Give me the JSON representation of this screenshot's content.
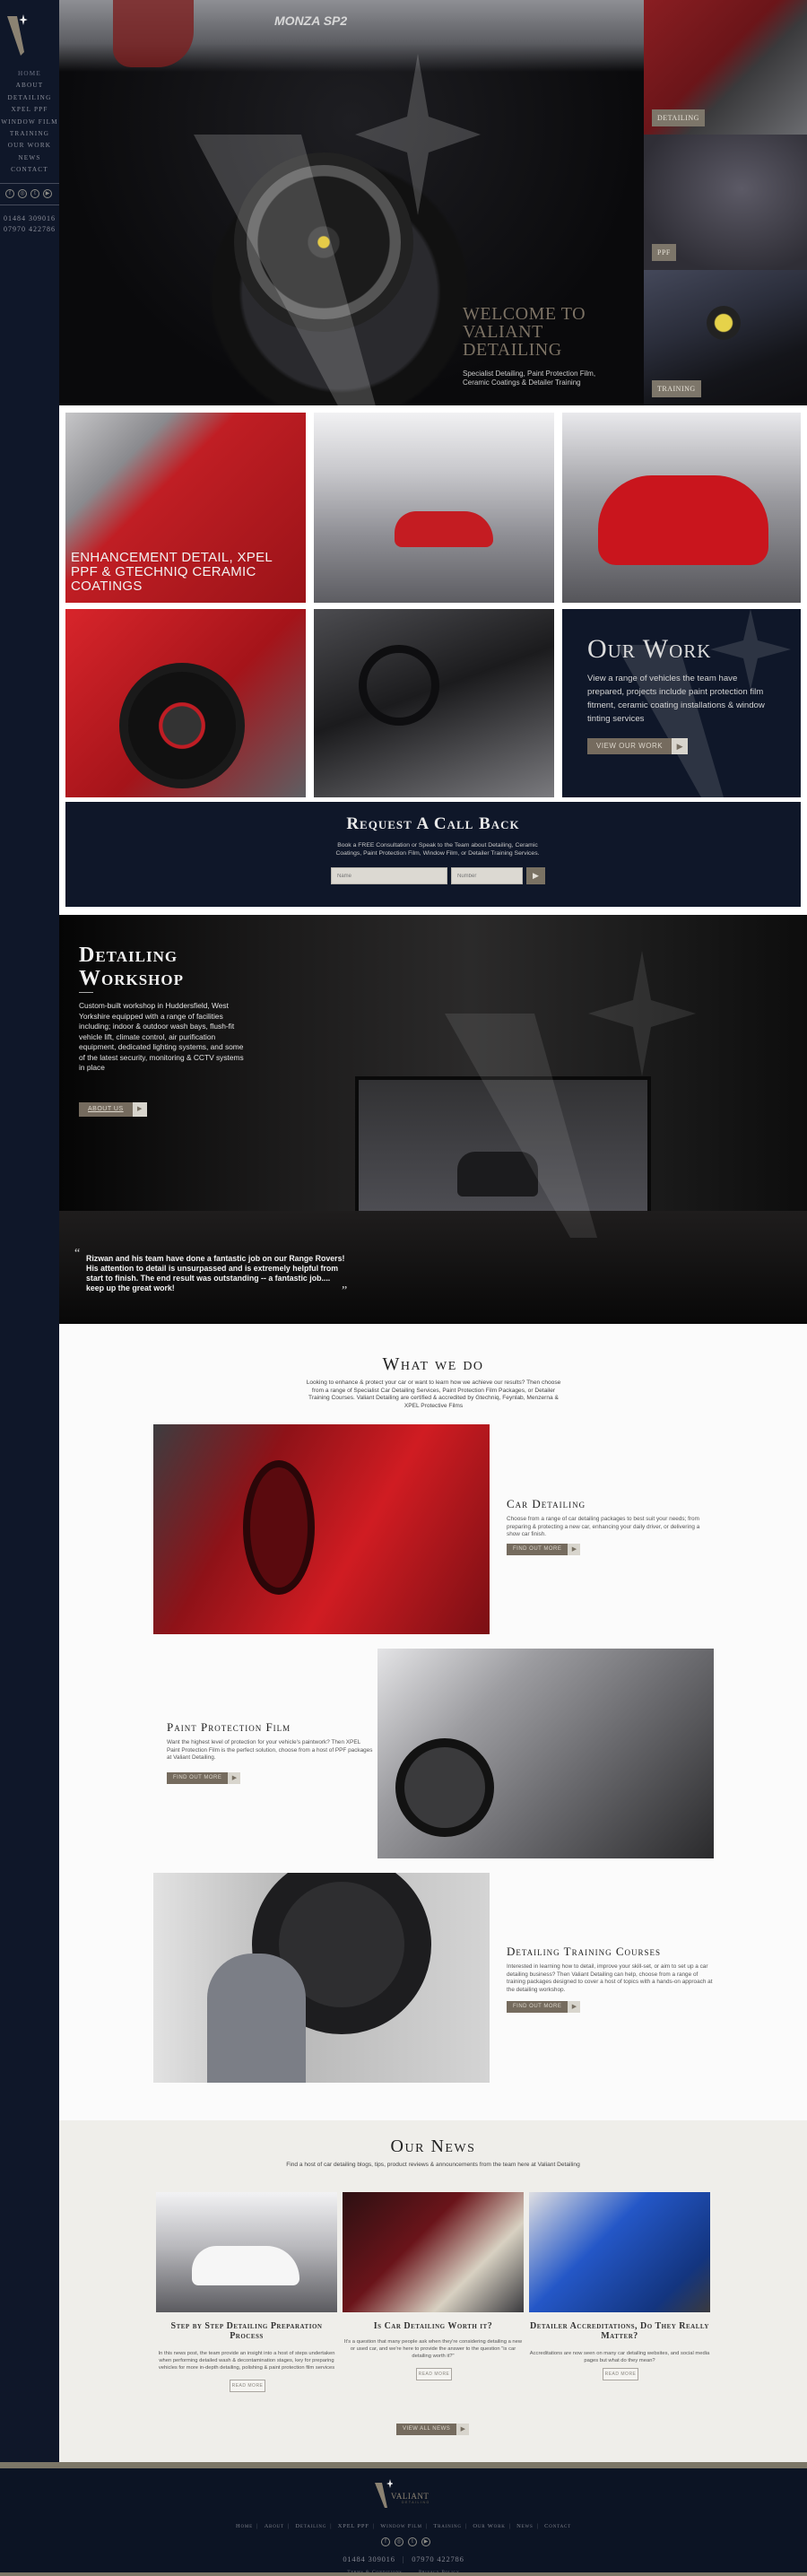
{
  "brand": {
    "name": "VALIANT",
    "tagline": "DETAILING",
    "colors": {
      "navy": "#0f1729",
      "taupe": "#756b5e",
      "light": "#dcd9d2",
      "cream": "#efeeea"
    }
  },
  "sidebar": {
    "nav": [
      "Home",
      "About",
      "Detailing",
      "XPEL PPF",
      "Window Film",
      "Training",
      "Our Work",
      "News",
      "Contact"
    ],
    "social": [
      {
        "icon": "facebook-icon",
        "glyph": "f"
      },
      {
        "icon": "instagram-icon",
        "glyph": "◎"
      },
      {
        "icon": "twitter-icon",
        "glyph": "t"
      },
      {
        "icon": "youtube-icon",
        "glyph": "▶"
      }
    ],
    "phones": [
      "01484 309016",
      "07970 422786"
    ]
  },
  "hero": {
    "car_badge": "MONZA SP2",
    "title_lines": [
      "Welcome to",
      "Valiant",
      "Detailing"
    ],
    "subtitle_lines": [
      "Specialist Detailing, Paint Protection Film,",
      "Ceramic Coatings & Detailer Training"
    ],
    "tiles": [
      {
        "label": "Detailing"
      },
      {
        "label": "PPF"
      },
      {
        "label": "Training"
      }
    ]
  },
  "gallery": {
    "caption_lines": [
      "Enhancement Detail, XPEL",
      "PPF & Gtechniq Ceramic",
      "Coatings"
    ],
    "our_work": {
      "title": "Our Work",
      "text": "View a range of vehicles the team have prepared, projects include paint protection film fitment, ceramic coating installations & window tinting services",
      "button": "View Our Work"
    },
    "callback": {
      "title": "Request A Call Back",
      "text_lines": [
        "Book a FREE Consultation or Speak to the Team about Detailing, Ceramic",
        "Coatings, Paint Protection Film, Window Film, or Detailer Training Services."
      ],
      "name_placeholder": "Name",
      "number_placeholder": "Number",
      "submit_glyph": "▶"
    }
  },
  "workshop": {
    "title_lines": [
      "Detailing",
      "Workshop"
    ],
    "text": "Custom-built workshop in Huddersfield, West Yorkshire equipped with a range of facilities including; indoor & outdoor wash bays, flush-fit vehicle lift, climate control, air purification equipment, dedicated lighting systems, and some of the latest security, monitoring & CCTV systems in place",
    "button": "About Us",
    "quote_open": "“",
    "quote": "Rizwan and his team have done a fantastic job on our Range Rovers! His attention to detail is unsurpassed and is extremely helpful from start to finish. The end result was outstanding -- a fantastic job.... keep up the great work!",
    "quote_close": "”"
  },
  "what_we_do": {
    "title": "What we do",
    "text": "Looking to enhance & protect your car or want to learn how we achieve our results? Then choose from a range of Specialist Car Detailing Services, Paint Protection Film Packages, or Detailer Training Courses. Valiant Detailing are certified & accredited by Gtechniq, Feynlab, Menzerna & XPEL Protective Films",
    "services": [
      {
        "title": "Car Detailing",
        "text": "Choose from a range of car detailing packages to best suit your needs; from preparing & protecting a new car, enhancing your daily driver, or delivering a show car finish.",
        "button": "Find Out More"
      },
      {
        "title": "Paint Protection Film",
        "text": "Want the highest level of protection for your vehicle's paintwork? Then XPEL Paint Protection Film is the perfect solution, choose from a host of PPF packages at Valiant Detailing.",
        "button": "Find Out More"
      },
      {
        "title": "Detailing Training Courses",
        "text": "Interested in learning how to detail, improve your skill-set, or aim to set up a car detailing business? Then Valiant Detailing can help, choose from a range of training packages designed to cover a host of topics with a hands-on approach at the detailing workshop.",
        "button": "Find Out More"
      }
    ]
  },
  "news": {
    "title": "Our News",
    "text": "Find a host of car detailing blogs, tips, product reviews & announcements from the team here at Valiant Detailing",
    "posts": [
      {
        "title": "Step by Step Detailing Preparation Process",
        "text": "In this news post, the team provide an insight into a host of steps undertaken when performing detailed wash & decontamination stages, key for preparing vehicles for more in-depth detailing, polishing & paint protection film services",
        "button": "Read More"
      },
      {
        "title": "Is Car Detailing Worth it?",
        "text": "It's a question that many people ask when they're considering detailing a new or used car, and we're here to provide the answer to the question \"is car detailing worth it?\"",
        "button": "Read More"
      },
      {
        "title": "Detailer Accreditations, Do They Really Matter?",
        "text": "Accreditations are now seen on many car detailing websites, and social media pages but what do they mean?",
        "button": "Read More"
      }
    ],
    "view_all": "View All News"
  },
  "footer": {
    "nav": [
      "Home",
      "About",
      "Detailing",
      "XPEL PPF",
      "Window Film",
      "Training",
      "Our Work",
      "News",
      "Contact"
    ],
    "phones": [
      "01484 309016",
      "07970 422786"
    ],
    "legal": [
      "Terms & Conditions",
      "Privacy Policy"
    ]
  }
}
